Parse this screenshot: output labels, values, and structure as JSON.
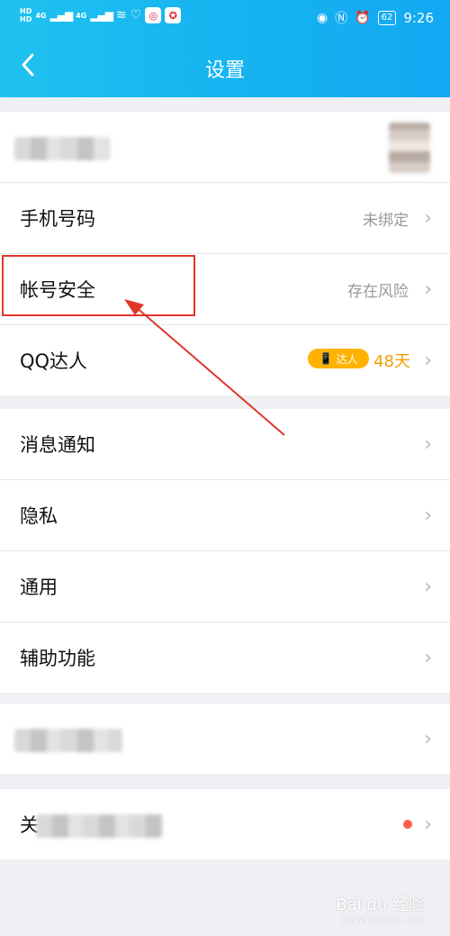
{
  "status_bar": {
    "hd_top": "HD",
    "hd_bottom": "HD",
    "net1": "4G",
    "net2": "4G",
    "battery": "62",
    "time": "9:26"
  },
  "header": {
    "back_label": "<",
    "title": "设置"
  },
  "group1": {
    "phone_label": "手机号码",
    "phone_value": "未绑定",
    "security_label": "帐号安全",
    "security_value": "存在风险",
    "daren_label": "QQ达人",
    "daren_badge": "达人",
    "daren_days": "48天"
  },
  "group2": {
    "notify_label": "消息通知",
    "privacy_label": "隐私",
    "general_label": "通用",
    "accessibility_label": "辅助功能"
  },
  "group4": {
    "partial_label": "关"
  },
  "chevron": "›",
  "watermark": {
    "brand": "Bai du 经验",
    "url": "jingyan.baidu.com"
  },
  "colors": {
    "header_bg": "#16b4f0",
    "highlight": "#e0372b",
    "badge": "#ffb300"
  }
}
